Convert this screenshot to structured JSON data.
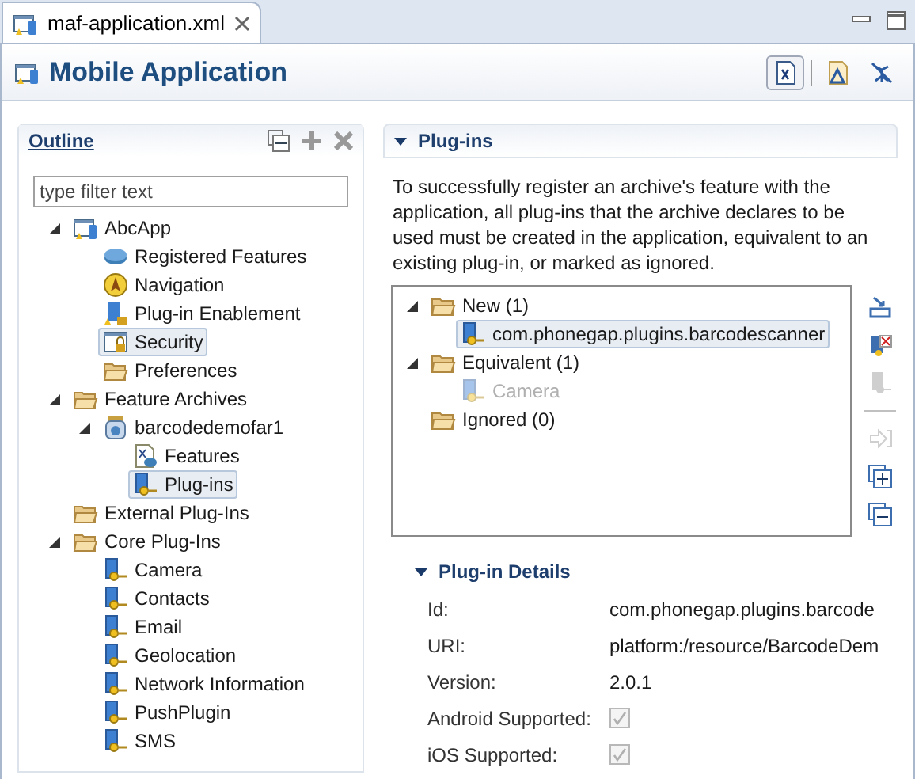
{
  "editor_tab": {
    "label": "maf-application.xml"
  },
  "header": {
    "title": "Mobile Application",
    "buttons": [
      {
        "kind": "xml",
        "selected": true
      },
      {
        "kind": "deploy",
        "selected": false
      },
      {
        "kind": "debug",
        "selected": false
      }
    ]
  },
  "outline": {
    "title": "Outline",
    "filter": {
      "placeholder": "type filter text"
    },
    "tree": [
      {
        "label": "AbcApp",
        "kind": "app",
        "expanded": true,
        "selected": false,
        "children": [
          {
            "label": "Registered Features",
            "kind": "features",
            "selected": false
          },
          {
            "label": "Navigation",
            "kind": "navigation",
            "selected": false
          },
          {
            "label": "Plug-in Enablement",
            "kind": "plugin-lock",
            "selected": false
          },
          {
            "label": "Security",
            "kind": "security",
            "selected": true
          },
          {
            "label": "Preferences",
            "kind": "folder",
            "selected": false
          }
        ]
      },
      {
        "label": "Feature Archives",
        "kind": "folder",
        "expanded": true,
        "selected": false,
        "children": [
          {
            "label": "barcodedemofar1",
            "kind": "archive",
            "expanded": true,
            "selected": false,
            "children": [
              {
                "label": "Features",
                "kind": "xfeature",
                "selected": false
              },
              {
                "label": "Plug-ins",
                "kind": "plugin",
                "selected": true
              }
            ]
          }
        ]
      },
      {
        "label": "External Plug-Ins",
        "kind": "folder",
        "selected": false
      },
      {
        "label": "Core Plug-Ins",
        "kind": "folder",
        "expanded": true,
        "selected": false,
        "children": [
          {
            "label": "Camera",
            "kind": "plugin",
            "selected": false
          },
          {
            "label": "Contacts",
            "kind": "plugin",
            "selected": false
          },
          {
            "label": "Email",
            "kind": "plugin",
            "selected": false
          },
          {
            "label": "Geolocation",
            "kind": "plugin",
            "selected": false
          },
          {
            "label": "Network Information",
            "kind": "plugin",
            "selected": false
          },
          {
            "label": "PushPlugin",
            "kind": "plugin",
            "selected": false
          },
          {
            "label": "SMS",
            "kind": "plugin",
            "selected": false
          }
        ]
      }
    ]
  },
  "plugins": {
    "title": "Plug-ins",
    "expanded": true,
    "description": "To successfully register an archive's feature with the application, all plug-ins that the archive  declares to be used must be created in the application, equivalent to an existing plug-in, or marked as ignored.",
    "tree": [
      {
        "label": "New (1)",
        "kind": "folder",
        "expanded": true,
        "selected": false,
        "disabled": false,
        "children": [
          {
            "label": "com.phonegap.plugins.barcodescanner",
            "kind": "plugin",
            "selected": true,
            "disabled": false
          }
        ]
      },
      {
        "label": "Equivalent (1)",
        "kind": "folder",
        "expanded": true,
        "selected": false,
        "disabled": false,
        "children": [
          {
            "label": "Camera",
            "kind": "plugin",
            "selected": false,
            "disabled": true
          }
        ]
      },
      {
        "label": "Ignored (0)",
        "kind": "folder",
        "selected": false,
        "disabled": false
      }
    ],
    "side_buttons": [
      {
        "kind": "create",
        "disabled": false
      },
      {
        "kind": "ignore",
        "disabled": false
      },
      {
        "kind": "equivalent",
        "disabled": true
      },
      {
        "kind": "separator"
      },
      {
        "kind": "move",
        "disabled": true
      },
      {
        "kind": "expand-all",
        "disabled": false
      },
      {
        "kind": "collapse-all",
        "disabled": false
      }
    ]
  },
  "details": {
    "title": "Plug-in Details",
    "expanded": true,
    "fields": [
      {
        "label": "Id:",
        "kind": "text",
        "value": "com.phonegap.plugins.barcode"
      },
      {
        "label": "URI:",
        "kind": "text",
        "value": "platform:/resource/BarcodeDem"
      },
      {
        "label": "Version:",
        "kind": "text",
        "value": "2.0.1"
      },
      {
        "label": "Android Supported:",
        "kind": "checkbox",
        "checked": true,
        "disabled": true
      },
      {
        "label": "iOS Supported:",
        "kind": "checkbox",
        "checked": true,
        "disabled": true
      }
    ]
  }
}
